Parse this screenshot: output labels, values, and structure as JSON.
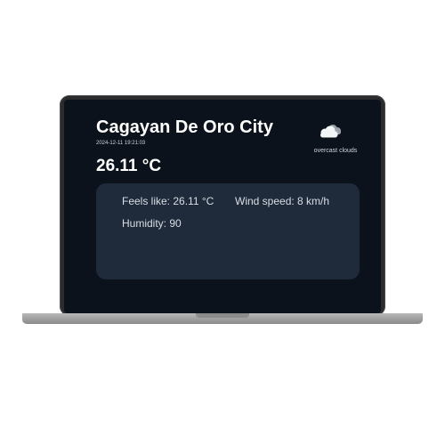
{
  "weather": {
    "city": "Cagayan De Oro City",
    "datetime": "2024-12-11 19:21:03",
    "temperature": "26.11 °C",
    "condition": "overcast clouds",
    "icon": "overcast-clouds-icon",
    "details": {
      "feels_like": "Feels like: 26.11 °C",
      "wind_speed": "Wind speed: 8 km/h",
      "humidity": "Humidity: 90"
    }
  },
  "colors": {
    "screen_bg": "#0b121c",
    "card_bg": "#1f2a3a",
    "text_primary": "#ffffff"
  }
}
